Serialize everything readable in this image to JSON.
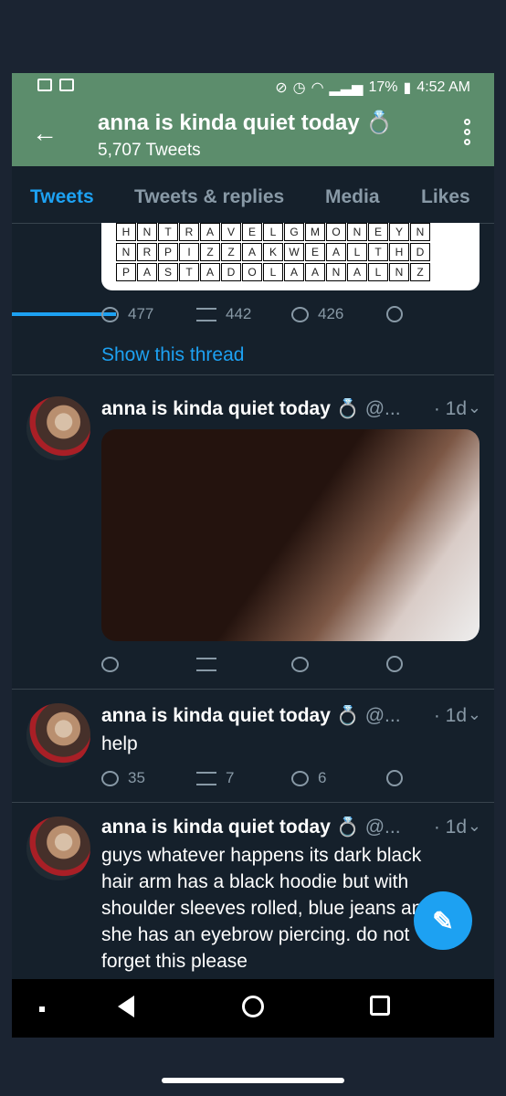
{
  "status_bar": {
    "battery": "17%",
    "time": "4:52 AM"
  },
  "header": {
    "title": "anna is kinda quiet today 💍",
    "tweet_count": "5,707 Tweets"
  },
  "tabs": [
    "Tweets",
    "Tweets & replies",
    "Media",
    "Likes"
  ],
  "grid_rows": [
    [
      "H",
      "N",
      "T",
      "R",
      "A",
      "V",
      "E",
      "L",
      "G",
      "M",
      "O",
      "N",
      "E",
      "Y",
      "N"
    ],
    [
      "N",
      "R",
      "P",
      "I",
      "Z",
      "Z",
      "A",
      "K",
      "W",
      "E",
      "A",
      "L",
      "T",
      "H",
      "D"
    ],
    [
      "P",
      "A",
      "S",
      "T",
      "A",
      "D",
      "O",
      "L",
      "A",
      "A",
      "N",
      "A",
      "L",
      "N",
      "Z"
    ]
  ],
  "tweets": [
    {
      "replies": "477",
      "retweets": "442",
      "likes": "426",
      "show_thread": "Show this thread"
    },
    {
      "author": "anna is kinda quiet today 💍",
      "handle": "@...",
      "time": "· 1d",
      "replies": "",
      "retweets": "",
      "likes": ""
    },
    {
      "author": "anna is kinda quiet today 💍",
      "handle": "@...",
      "time": "· 1d",
      "text": "help",
      "replies": "35",
      "retweets": "7",
      "likes": "6"
    },
    {
      "author": "anna is kinda quiet today 💍",
      "handle": "@...",
      "time": "· 1d",
      "text": "guys whatever happens its dark black hair arm has a black hoodie but with shoulder sleeves rolled, blue jeans and she has an eyebrow piercing. do not forget this please"
    }
  ],
  "colors": {
    "header_green": "#5c8d6c",
    "background": "#15202b",
    "accent_blue": "#1da1f2"
  }
}
